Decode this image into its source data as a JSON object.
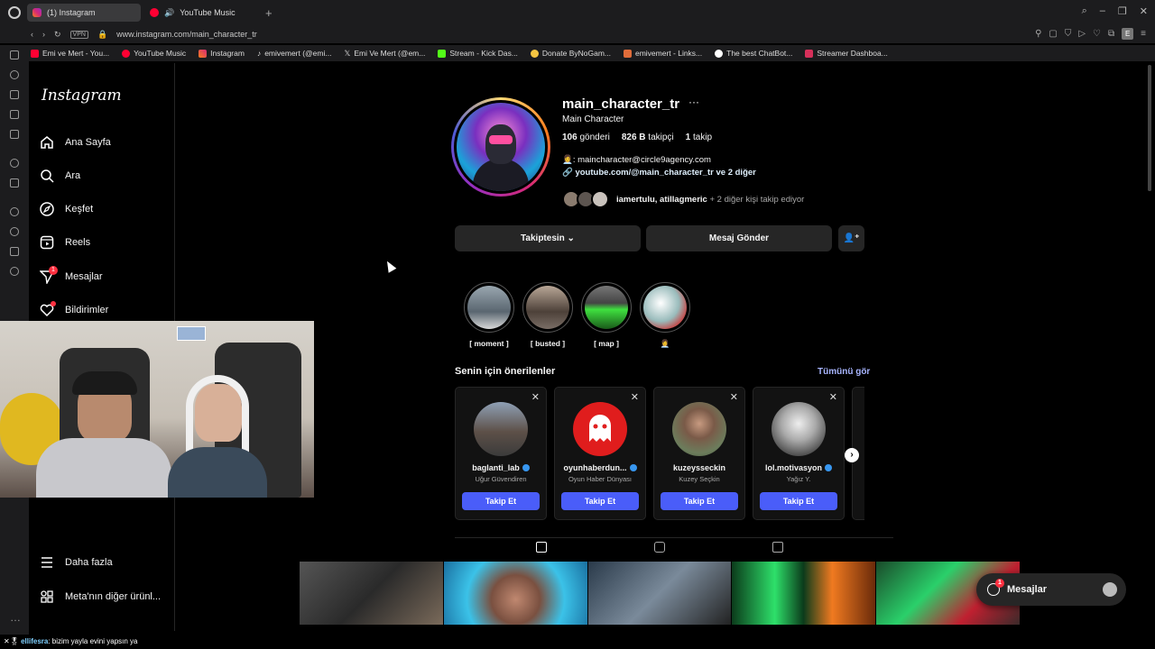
{
  "browser": {
    "tabs": [
      {
        "label": "(1) Instagram",
        "active": true
      },
      {
        "label": "YouTube Music",
        "active": false
      }
    ],
    "vpn_label": "VPN",
    "url": "www.instagram.com/main_character_tr",
    "profile_initial": "E",
    "bookmarks": [
      "Emi ve Mert - You...",
      "YouTube Music",
      "Instagram",
      "emivemert (@emi...",
      "Emi Ve Mert (@em...",
      "Stream - Kick Das...",
      "Donate ByNoGam...",
      "emivemert - Links...",
      "The best ChatBot...",
      "Streamer Dashboa..."
    ]
  },
  "ig_nav": {
    "logo": "Instagram",
    "items": [
      {
        "label": "Ana Sayfa",
        "icon": "home-icon"
      },
      {
        "label": "Ara",
        "icon": "search-icon"
      },
      {
        "label": "Keşfet",
        "icon": "compass-icon"
      },
      {
        "label": "Reels",
        "icon": "reels-icon"
      },
      {
        "label": "Mesajlar",
        "icon": "send-icon",
        "badge": "1"
      },
      {
        "label": "Bildirimler",
        "icon": "heart-icon"
      }
    ],
    "more": "Daha fazla",
    "meta": "Meta'nın diğer ürünl..."
  },
  "profile": {
    "username": "main_character_tr",
    "more_icon": "···",
    "full_name": "Main Character",
    "posts_count": "106",
    "posts_label": "gönderi",
    "followers_count": "826 B",
    "followers_label": "takipçi",
    "following_count": "1",
    "following_label": "takip",
    "bio_email": "👩‍💼: maincharacter@circle9agency.com",
    "bio_link": "youtube.com/@main_character_tr ve 2 diğer",
    "followed_by_names": "iamertulu, atillagmeric",
    "followed_by_rest": " + 2 diğer kişi takip ediyor"
  },
  "actions": {
    "following": "Takiptesin",
    "message": "Mesaj Gönder"
  },
  "highlights": [
    {
      "label": "[ moment ]"
    },
    {
      "label": "[ busted ]"
    },
    {
      "label": "[ map ]"
    },
    {
      "label": "👩‍💼"
    }
  ],
  "suggestions": {
    "title": "Senin için önerilenler",
    "see_all": "Tümünü gör",
    "cards": [
      {
        "username": "baglanti_lab",
        "subtitle": "Uğur Güvendiren",
        "button": "Takip Et",
        "verified": true
      },
      {
        "username": "oyunhaberdun...",
        "subtitle": "Oyun Haber Dünyası",
        "button": "Takip Et",
        "verified": true
      },
      {
        "username": "kuzeysseckin",
        "subtitle": "Kuzey Seçkin",
        "button": "Takip Et",
        "verified": false
      },
      {
        "username": "lol.motivasyon",
        "subtitle": "Yağız Y.",
        "button": "Takip Et",
        "verified": true
      }
    ]
  },
  "floating_messages": {
    "label": "Mesajlar",
    "badge": "1"
  },
  "chat": {
    "user": "ellifesra",
    "message": ": bizim yayla evini yapsın ya"
  },
  "colors": {
    "accent_button": "#4a5df9",
    "link": "#a8b5ff",
    "badge": "#ff3040"
  }
}
